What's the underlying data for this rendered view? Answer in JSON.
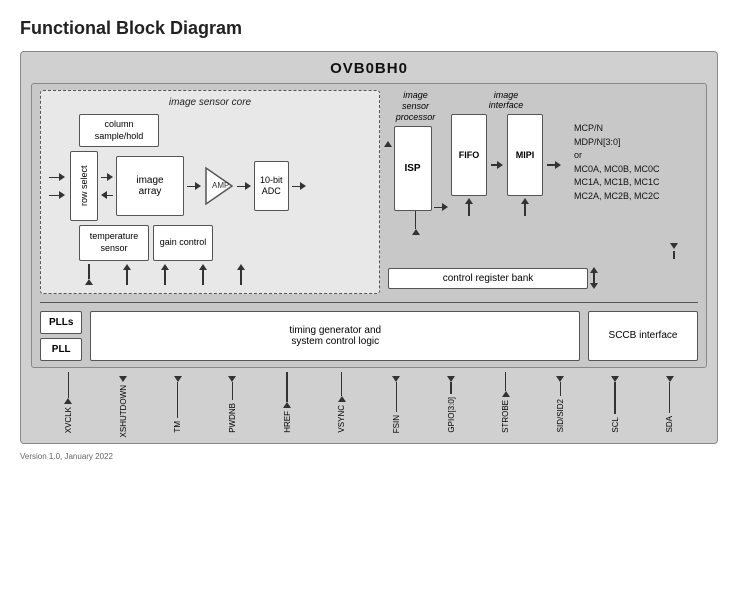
{
  "title": "Functional Block Diagram",
  "outer_chip_label": "OVB0BH0",
  "isc": {
    "label": "image sensor core",
    "column_sample_hold": "column\nsample/hold",
    "row_select": "row select",
    "image_array": "image\narray",
    "temperature_sensor": "temperature\nsensor",
    "gain_control": "gain\ncontrol",
    "amp": "AMP",
    "adc": "10-bit\nADC"
  },
  "isp_label": "image\nsensor\nprocessor",
  "isp": "ISP",
  "image_interface_label": "image\ninterface",
  "fifo": "FIFO",
  "mipi": "MIPI",
  "mcp_label": "MCP/N\nMDP/N[3:0]\nor\nMC0A, MC0B, MC0C\nMC1A, MC1B, MC1C\nMC2A, MC2B, MC2C",
  "control_register_bank": "control register bank",
  "plls_label": "PLLs",
  "pll_label": "PLL",
  "timing_label": "timing generator and\nsystem control logic",
  "sccb_label": "SCCB interface",
  "signals": [
    "XVCLK",
    "XSHUTDOWN",
    "TM",
    "PWDNB",
    "HREF",
    "VSYNC",
    "FSIN",
    "GPIO[3:0]",
    "STROBE",
    "SID/SID2",
    "SCL",
    "SDA"
  ],
  "version": "Version 1.0, January 2022"
}
